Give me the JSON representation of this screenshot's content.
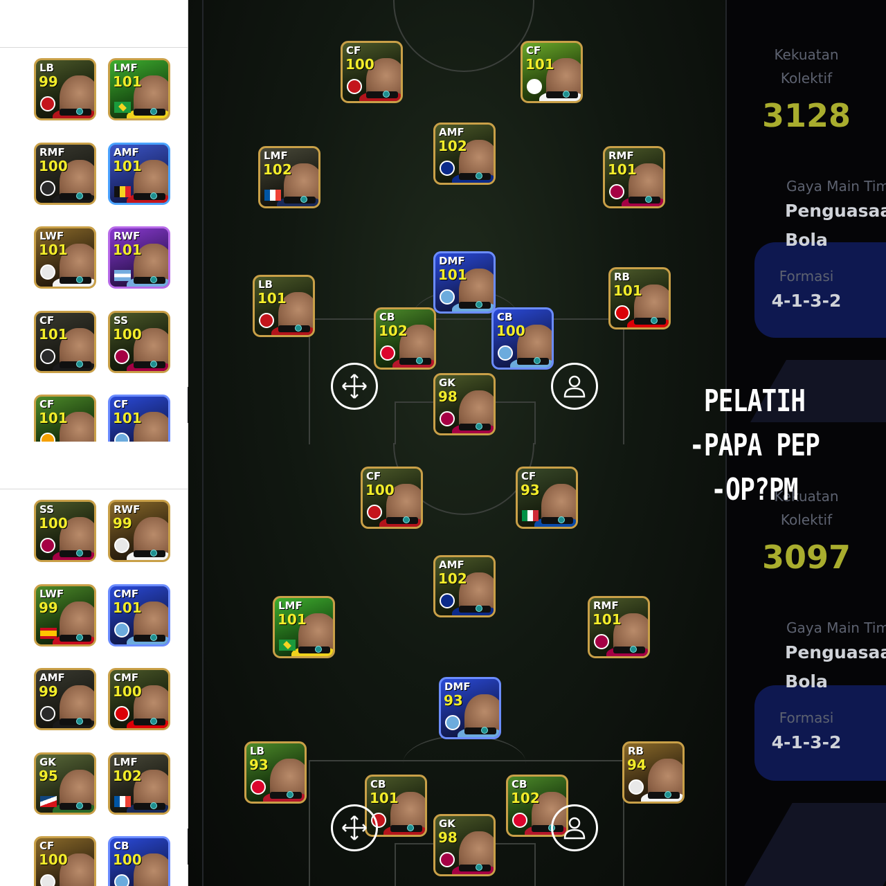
{
  "left_panel": {
    "top_group": [
      {
        "pos": "LB",
        "rating": "99",
        "club": "milan"
      },
      {
        "pos": "LMF",
        "rating": "101",
        "club": "brazil"
      },
      {
        "pos": "RMF",
        "rating": "100",
        "club": "dark"
      },
      {
        "pos": "AMF",
        "rating": "101",
        "club": "belgium"
      },
      {
        "pos": "LWF",
        "rating": "101",
        "club": "white"
      },
      {
        "pos": "RWF",
        "rating": "101",
        "club": "argentina"
      },
      {
        "pos": "CF",
        "rating": "101",
        "club": "dark"
      },
      {
        "pos": "SS",
        "rating": "100",
        "club": "barca"
      },
      {
        "pos": "CF",
        "rating": "101",
        "club": "gala"
      },
      {
        "pos": "CF",
        "rating": "101",
        "club": "city"
      }
    ],
    "bottom_group": [
      {
        "pos": "SS",
        "rating": "100",
        "club": "barca"
      },
      {
        "pos": "RWF",
        "rating": "99",
        "club": "white"
      },
      {
        "pos": "LWF",
        "rating": "99",
        "club": "spain"
      },
      {
        "pos": "CMF",
        "rating": "101",
        "club": "city"
      },
      {
        "pos": "AMF",
        "rating": "99",
        "club": "dark"
      },
      {
        "pos": "CMF",
        "rating": "100",
        "club": "arsenal"
      },
      {
        "pos": "GK",
        "rating": "95",
        "club": "czech"
      },
      {
        "pos": "LMF",
        "rating": "102",
        "club": "france"
      },
      {
        "pos": "CF",
        "rating": "100",
        "club": "white"
      },
      {
        "pos": "CB",
        "rating": "100",
        "club": "city"
      }
    ]
  },
  "pitch_top": [
    {
      "pos": "CF",
      "rating": "100",
      "club": "milan"
    },
    {
      "pos": "CF",
      "rating": "101",
      "club": "santos"
    },
    {
      "pos": "AMF",
      "rating": "102",
      "club": "inter"
    },
    {
      "pos": "LMF",
      "rating": "102",
      "club": "france"
    },
    {
      "pos": "RMF",
      "rating": "101",
      "club": "barca"
    },
    {
      "pos": "DMF",
      "rating": "101",
      "club": "city"
    },
    {
      "pos": "LB",
      "rating": "101",
      "club": "milan"
    },
    {
      "pos": "RB",
      "rating": "101",
      "club": "arsenal"
    },
    {
      "pos": "CB",
      "rating": "102",
      "club": "bayern"
    },
    {
      "pos": "CB",
      "rating": "100",
      "club": "city"
    },
    {
      "pos": "GK",
      "rating": "98",
      "club": "barca"
    }
  ],
  "pitch_bottom": [
    {
      "pos": "CF",
      "rating": "100",
      "club": "milan"
    },
    {
      "pos": "CF",
      "rating": "93",
      "club": "italy"
    },
    {
      "pos": "AMF",
      "rating": "102",
      "club": "inter"
    },
    {
      "pos": "LMF",
      "rating": "101",
      "club": "brazil"
    },
    {
      "pos": "RMF",
      "rating": "101",
      "club": "barca"
    },
    {
      "pos": "DMF",
      "rating": "93",
      "club": "city"
    },
    {
      "pos": "LB",
      "rating": "93",
      "club": "bayern"
    },
    {
      "pos": "RB",
      "rating": "94",
      "club": "white"
    },
    {
      "pos": "CB",
      "rating": "101",
      "club": "milan"
    },
    {
      "pos": "CB",
      "rating": "102",
      "club": "bayern"
    },
    {
      "pos": "GK",
      "rating": "98",
      "club": "barca"
    }
  ],
  "right_panel": {
    "top": {
      "strength_label_1": "Kekuatan",
      "strength_label_2": "Kolektif",
      "strength_value": "3128",
      "style_label": "Gaya Main Tim",
      "style_value_1": "Penguasaan",
      "style_value_2": "Bola",
      "formation_label": "Formasi",
      "formation_value": "4-1-3-2"
    },
    "bottom": {
      "strength_label_1": "Kekuatan",
      "strength_label_2": "Kolektif",
      "strength_value": "3097",
      "style_label": "Gaya Main Tim",
      "style_value_1": "Penguasaan",
      "style_value_2": "Bola",
      "formation_label": "Formasi",
      "formation_value": "4-1-3-2"
    }
  },
  "overlay_text": {
    "line1": "PELATIH",
    "line2": "-PAPA PEP",
    "line3": "-OP?PM"
  },
  "colors": {
    "rating_yellow": "#f2ec2a",
    "stat_value": "#a9ad2e",
    "card_gold_border": "#c9a048",
    "pitch_dark": "#0d120c",
    "deco_blue": "#0e1850"
  },
  "icons": [
    "move-arrows-icon",
    "person-icon"
  ]
}
